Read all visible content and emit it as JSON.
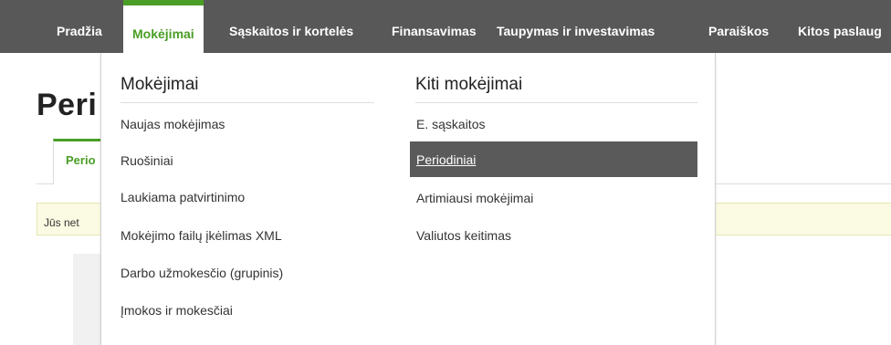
{
  "nav": {
    "items": [
      {
        "label": "Pradžia"
      },
      {
        "label": "Mokėjimai"
      },
      {
        "label": "Sąskaitos ir kortelės"
      },
      {
        "label": "Finansavimas"
      },
      {
        "label": "Taupymas ir investavimas"
      },
      {
        "label": "Paraiškos"
      },
      {
        "label": "Kitos paslaug"
      }
    ],
    "active_index": 1
  },
  "page": {
    "title": "Peri",
    "tab_label": "Perio",
    "notice": "Jūs net"
  },
  "dropdown": {
    "col1": {
      "heading": "Mokėjimai",
      "items": [
        "Naujas mokėjimas",
        "Ruošiniai",
        "Laukiama patvirtinimo",
        "Mokėjimo failų įkėlimas XML",
        "Darbo užmokesčio (grupinis)",
        "Įmokos ir mokesčiai"
      ]
    },
    "col2": {
      "heading": "Kiti mokėjimai",
      "items": [
        "E. sąskaitos",
        "Periodiniai",
        "Artimiausi mokėjimai",
        "Valiutos keitimas"
      ],
      "selected_index": 1
    }
  },
  "colors": {
    "nav_bg": "#585858",
    "accent_green": "#4a9e25",
    "highlight_bg": "#5a5a5a"
  }
}
